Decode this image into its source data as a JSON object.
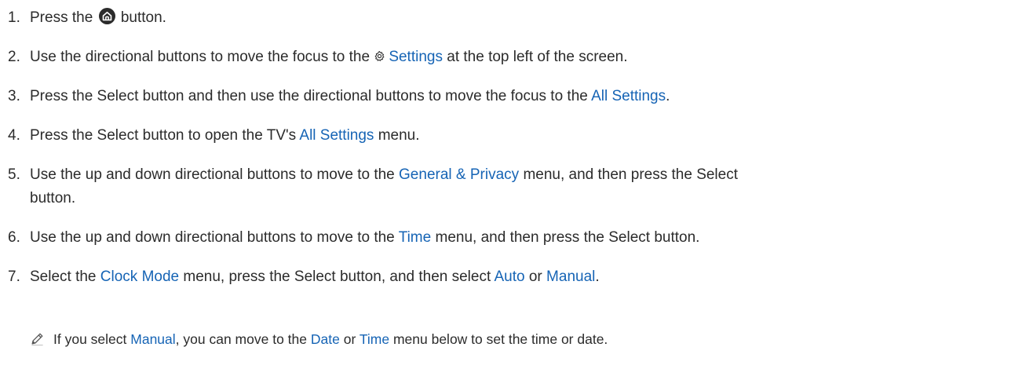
{
  "steps": [
    {
      "num": "1.",
      "t1": "Press the",
      "t2": "button."
    },
    {
      "num": "2.",
      "t1": "Use the directional buttons to move the focus to the",
      "link1": "Settings",
      "t2": "at the top left of the screen."
    },
    {
      "num": "3.",
      "t1": "Press the Select button and then use the directional buttons to move the focus to the",
      "link1": "All Settings",
      "t2": "."
    },
    {
      "num": "4.",
      "t1": "Press the Select button to open the TV's",
      "link1": "All Settings",
      "t2": "menu."
    },
    {
      "num": "5.",
      "t1": "Use the up and down directional buttons to move to the",
      "link1": "General & Privacy",
      "t2": "menu, and then press the Select",
      "t3": "button."
    },
    {
      "num": "6.",
      "t1": "Use the up and down directional buttons to move to the",
      "link1": "Time",
      "t2": "menu, and then press the Select button."
    },
    {
      "num": "7.",
      "t1": "Select the",
      "link1": "Clock Mode",
      "t2": "menu, press the Select button, and then select",
      "link2": "Auto",
      "t3": "or",
      "link3": "Manual",
      "t4": "."
    }
  ],
  "note": {
    "t1": "If you select",
    "link1": "Manual",
    "t2": ", you can move to the",
    "link2": "Date",
    "t3": "or",
    "link3": "Time",
    "t4": "menu below to set the time or date."
  },
  "colors": {
    "text": "#2b2b2b",
    "link": "#1664b5",
    "icon": "#2b2b2b"
  }
}
